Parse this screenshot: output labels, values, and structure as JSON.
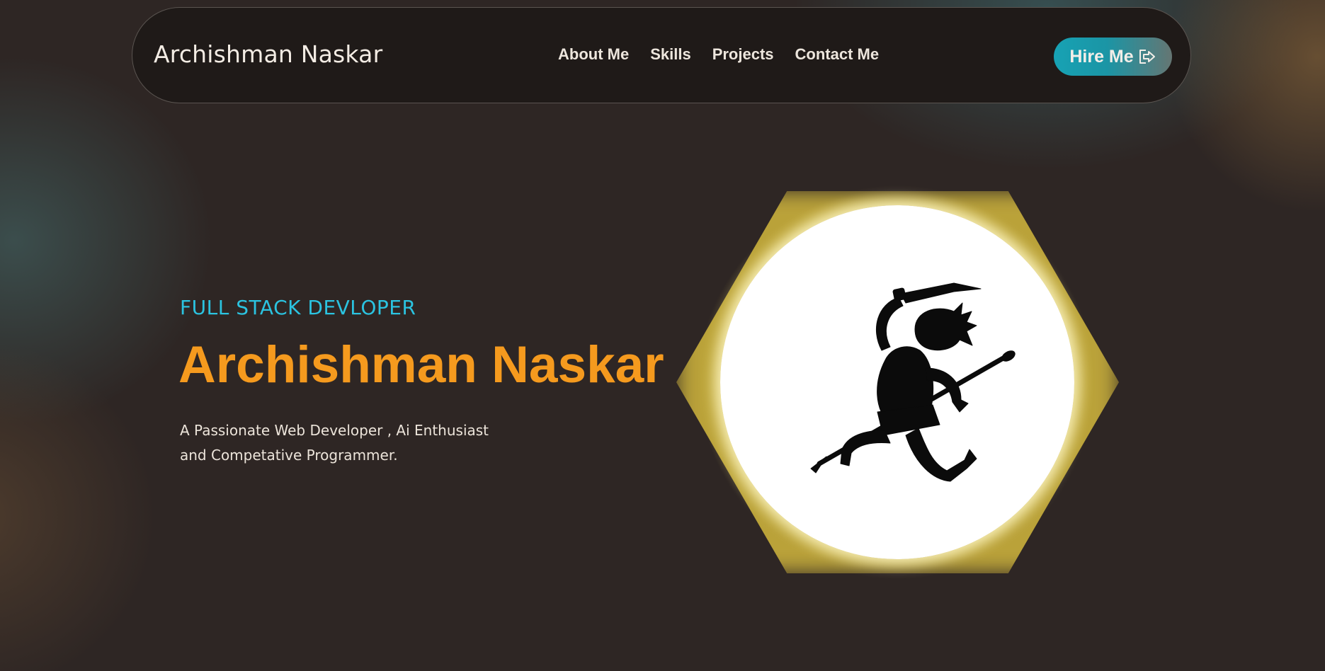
{
  "navbar": {
    "brand": "Archishman Naskar",
    "links": [
      "About Me",
      "Skills",
      "Projects",
      "Contact Me"
    ],
    "hire_button": {
      "label": "Hire Me",
      "icon": "sign-out-icon"
    }
  },
  "hero": {
    "subtitle": "FULL STACK DEVLOPER",
    "name": "Archishman Naskar",
    "description_line1": "A Passionate Web Developer , Ai Enthusiast",
    "description_line2": "and Competative Programmer."
  },
  "avatar": {
    "icon": "running-warrior-silhouette",
    "glow_color": "#c2a93b"
  },
  "colors": {
    "background": "#2e2624",
    "navbar_background": "#1f1a18",
    "accent_orange": "#f59a1e",
    "accent_cyan": "#2bc3e0",
    "button_teal": "#17a2b4"
  }
}
